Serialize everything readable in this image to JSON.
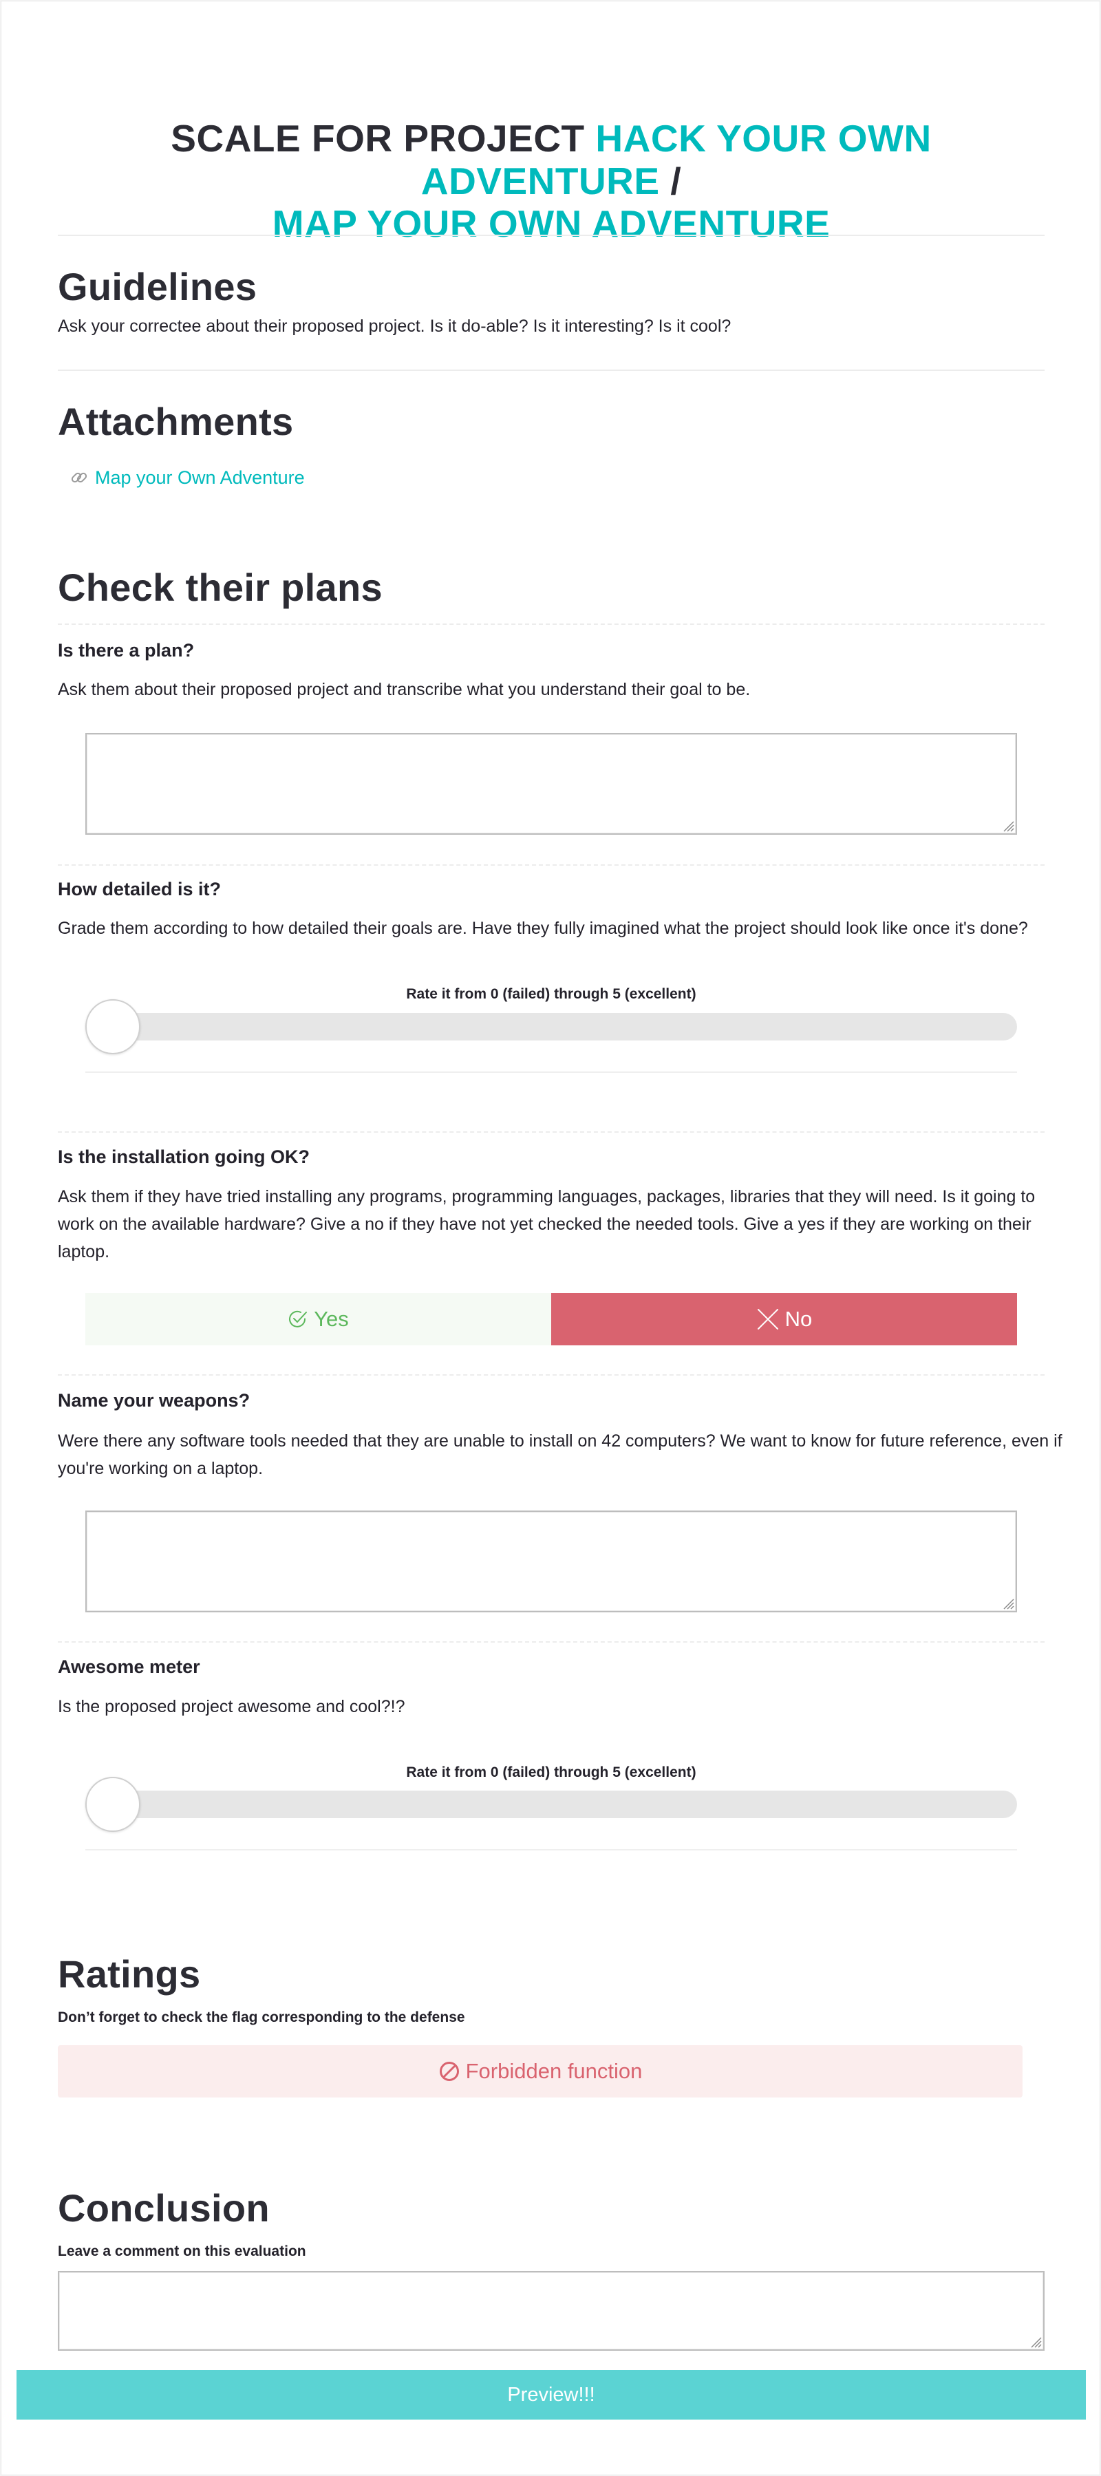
{
  "header": {
    "prefix": "SCALE FOR PROJECT",
    "project_name": "HACK YOUR OWN ADVENTURE",
    "separator": "/",
    "project_name_2": "MAP YOUR OWN ADVENTURE"
  },
  "guidelines": {
    "title": "Guidelines",
    "text": "Ask your correctee about their proposed project. Is it do-able? Is it interesting? Is it cool?"
  },
  "attachments": {
    "title": "Attachments",
    "items": [
      {
        "label": "Map your Own Adventure",
        "icon": "link-icon"
      }
    ]
  },
  "section": {
    "title": "Check their plans",
    "questions": [
      {
        "title": "Is there a plan?",
        "description": "Ask them about their proposed project and transcribe what you understand their goal to be.",
        "input": "textarea",
        "value": ""
      },
      {
        "title": "How detailed is it?",
        "description": "Grade them according to how detailed their goals are. Have they fully imagined what the project should look like once it's done?",
        "input": "slider",
        "slider_label": "Rate it from 0 (failed) through 5 (excellent)",
        "value": 0
      },
      {
        "title": "Is the installation going OK?",
        "description_lines": [
          "Ask them if they have tried installing any programs, programming languages, packages, libraries that they will need. Is it going to",
          "work on the available hardware? Give a no if they have not yet checked the needed tools. Give a yes if they are working on their",
          "laptop."
        ],
        "input": "yes-no",
        "yes_label": "Yes",
        "no_label": "No",
        "selected": "No"
      },
      {
        "title": "Name your weapons?",
        "description_lines": [
          "Were there any software tools needed that they are unable to install on 42 computers? We want to know for future reference, even if",
          "you're working on a laptop."
        ],
        "input": "textarea",
        "value": ""
      },
      {
        "title": "Awesome meter",
        "description": "Is the proposed project awesome and cool?!?",
        "input": "slider",
        "slider_label": "Rate it from 0 (failed) through 5 (excellent)",
        "value": 0
      }
    ]
  },
  "ratings": {
    "title": "Ratings",
    "subtitle": "Don’t forget to check the flag corresponding to the defense",
    "flag_label": "Forbidden function",
    "flag_icon": "forbidden-icon"
  },
  "conclusion": {
    "title": "Conclusion",
    "subtitle": "Leave a comment on this evaluation",
    "value": ""
  },
  "preview_button": "Preview!!!",
  "colors": {
    "accent": "#00babc",
    "no_red": "#d9636f",
    "yes_green": "#5cb85c",
    "preview": "#5bd3d3",
    "forbidden_bg": "#fbeded"
  }
}
